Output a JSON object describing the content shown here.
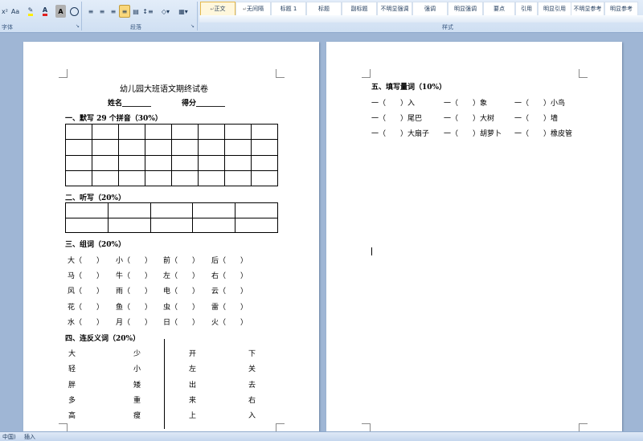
{
  "ribbon": {
    "font_group": {
      "caption": "字体",
      "size_label": "Aa",
      "char_border_label": "A"
    },
    "paragraph_group": {
      "caption": "段落"
    },
    "styles_group": {
      "caption": "样式",
      "styles": [
        "正文",
        "无间隔",
        "标题 1",
        "标题",
        "副标题",
        "不明显强调",
        "强调",
        "明显强调",
        "要点",
        "引用",
        "明显引用",
        "不明显参考",
        "明显参考"
      ]
    }
  },
  "page1": {
    "title": "幼儿园大班语文期终试卷",
    "name_label": "姓名________",
    "score_label": "得分________",
    "sec1": "一、默写 29 个拼音（30%）",
    "sec2": "二、听写（20%）",
    "sec3": "三、组词（20%）",
    "zuci": [
      [
        "大（　　）",
        "小（　　）",
        "前（　　）",
        "后（　　）"
      ],
      [
        "马（　　）",
        "牛（　　）",
        "左（　　）",
        "右（　　）"
      ],
      [
        "风（　　）",
        "雨（　　）",
        "电（　　）",
        "云（　　）"
      ],
      [
        "花（　　）",
        "鱼（　　）",
        "虫（　　）",
        "雷（　　）"
      ],
      [
        "水（　　）",
        "月（　　）",
        "日（　　）",
        "火（　　）"
      ]
    ],
    "sec4": "四、连反义词（20%）",
    "fanyi": [
      [
        "大",
        "少",
        "开",
        "下"
      ],
      [
        "轻",
        "小",
        "左",
        "关"
      ],
      [
        "胖",
        "矮",
        "出",
        "去"
      ],
      [
        "多",
        "重",
        "来",
        "右"
      ],
      [
        "高",
        "瘦",
        "上",
        "入"
      ]
    ]
  },
  "page2": {
    "sec5": "五、填写量词（10%）",
    "liangci": [
      [
        "一（　　）入",
        "一（　　）象",
        "一（　　）小鸟"
      ],
      [
        "一（　　）尾巴",
        "一（　　）大树",
        "一（　　）墙"
      ],
      [
        "一（　　）大扇子",
        "一（　　）胡萝卜",
        "一（　　）橡皮管"
      ]
    ]
  },
  "statusbar": {
    "language": "中国)",
    "mode": "插入"
  }
}
